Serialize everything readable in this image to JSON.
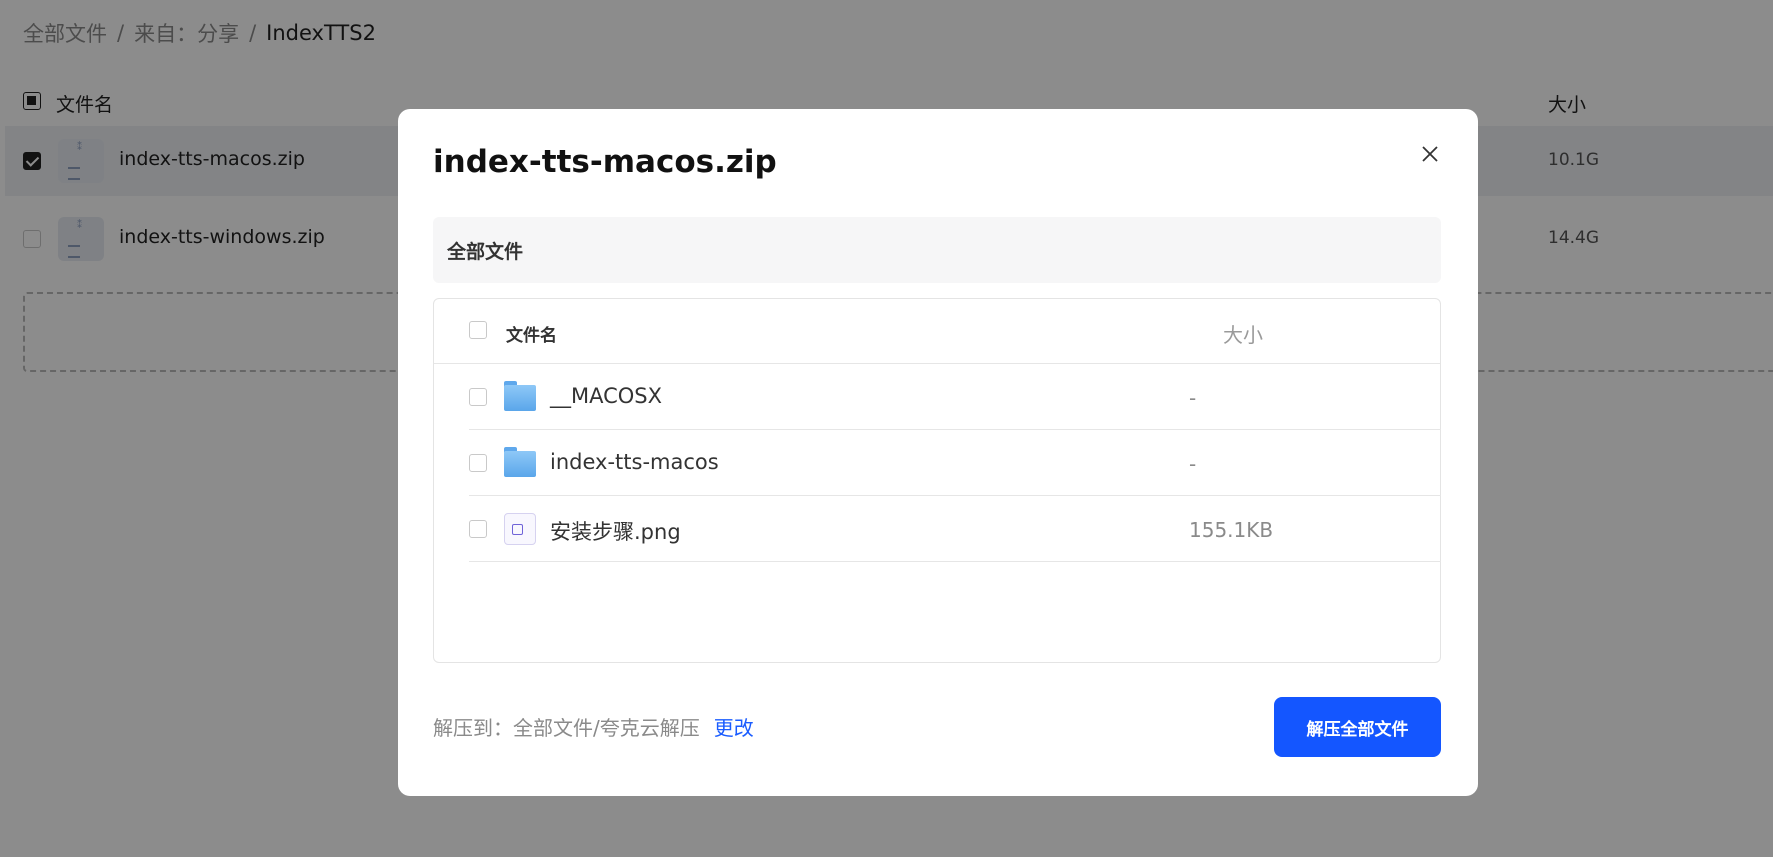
{
  "breadcrumb": {
    "root": "全部文件",
    "separator": "/",
    "middle": "来自：分享",
    "current": "IndexTTS2"
  },
  "file_list": {
    "header": {
      "name": "文件名",
      "size": "大小"
    },
    "rows": [
      {
        "name": "index-tts-macos.zip",
        "size": "10.1G",
        "checked": true
      },
      {
        "name": "index-tts-windows.zip",
        "size": "14.4G",
        "checked": false
      }
    ]
  },
  "modal": {
    "title": "index-tts-macos.zip",
    "close_icon": "close-icon",
    "path": "全部文件",
    "table": {
      "header": {
        "name": "文件名",
        "size": "大小"
      },
      "rows": [
        {
          "name": "__MACOSX",
          "size": "-",
          "icon": "folder-icon"
        },
        {
          "name": "index-tts-macos",
          "size": "-",
          "icon": "folder-icon"
        },
        {
          "name": "安装步骤.png",
          "size": "155.1KB",
          "icon": "image-file-icon"
        }
      ]
    },
    "extract": {
      "label": "解压到：全部文件/夸克云解压",
      "change": "更改"
    },
    "primary_button": "解压全部文件"
  },
  "colors": {
    "primary": "#1456ff",
    "link": "#1a5cff",
    "overlay": "rgba(0,0,0,0.45)",
    "folder": "#5aa6ea"
  }
}
